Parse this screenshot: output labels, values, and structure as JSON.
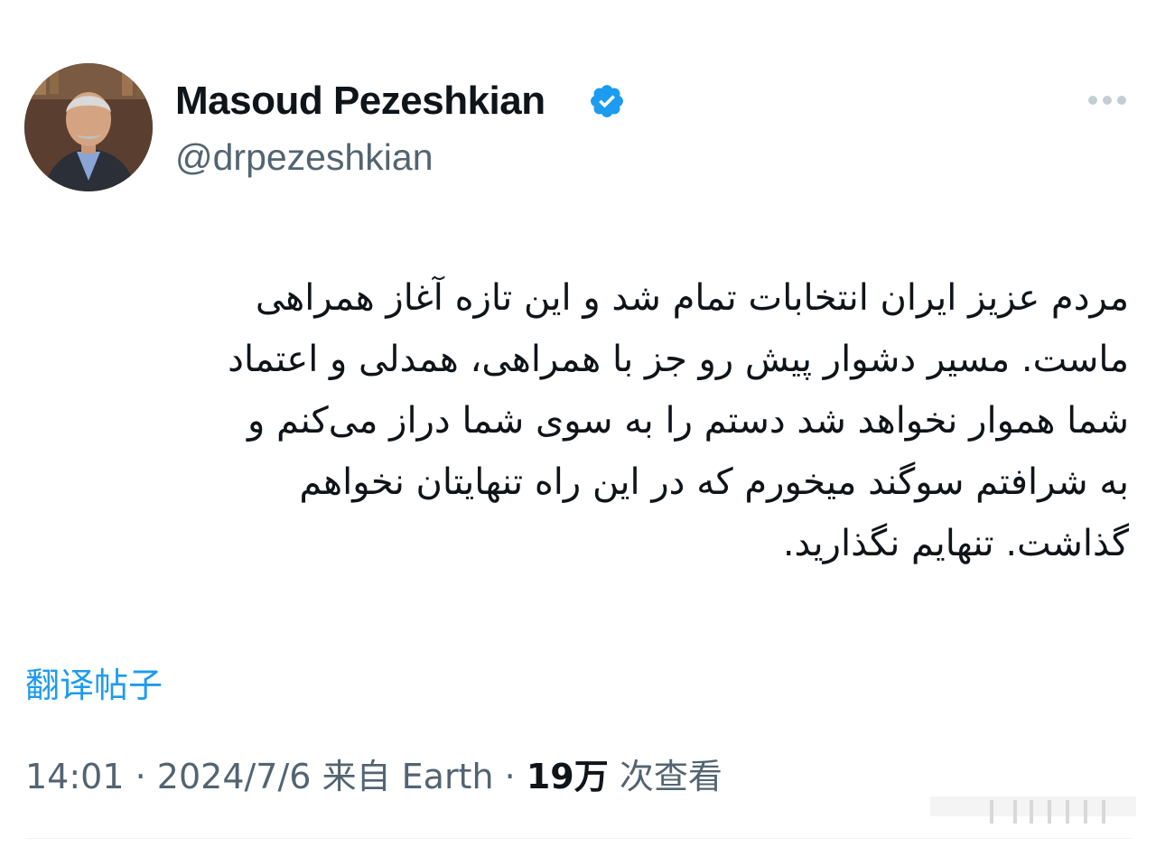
{
  "author": {
    "display_name": "Masoud Pezeshkian",
    "handle": "@drpezeshkian",
    "verified_icon": "verified-badge-icon",
    "avatar": "avatar-photo"
  },
  "actions": {
    "more_icon": "more-options-icon"
  },
  "tweet": {
    "text_lines": [
      "مردم عزیز ایران انتخابات تمام شد و این تازه آغاز همراهی",
      "ماست. مسیر دشوار پیش رو جز با همراهی، همدلی و اعتماد",
      "شما هموار نخواهد شد دستم را به سوی شما دراز می‌کنم و",
      "به شرافتم سوگند میخورم که در این راه تنهایتان نخواهم",
      "گذاشت. تنهایم نگذارید."
    ],
    "translate_label": "翻译帖子"
  },
  "meta": {
    "time": "14:01",
    "separator": "·",
    "date": "2024/7/6",
    "from_label": "来自 Earth",
    "views_count": "19万",
    "views_label": "次查看"
  },
  "colors": {
    "accent": "#1d9bf0",
    "secondary_text": "#536471",
    "primary_text": "#0f1419"
  }
}
